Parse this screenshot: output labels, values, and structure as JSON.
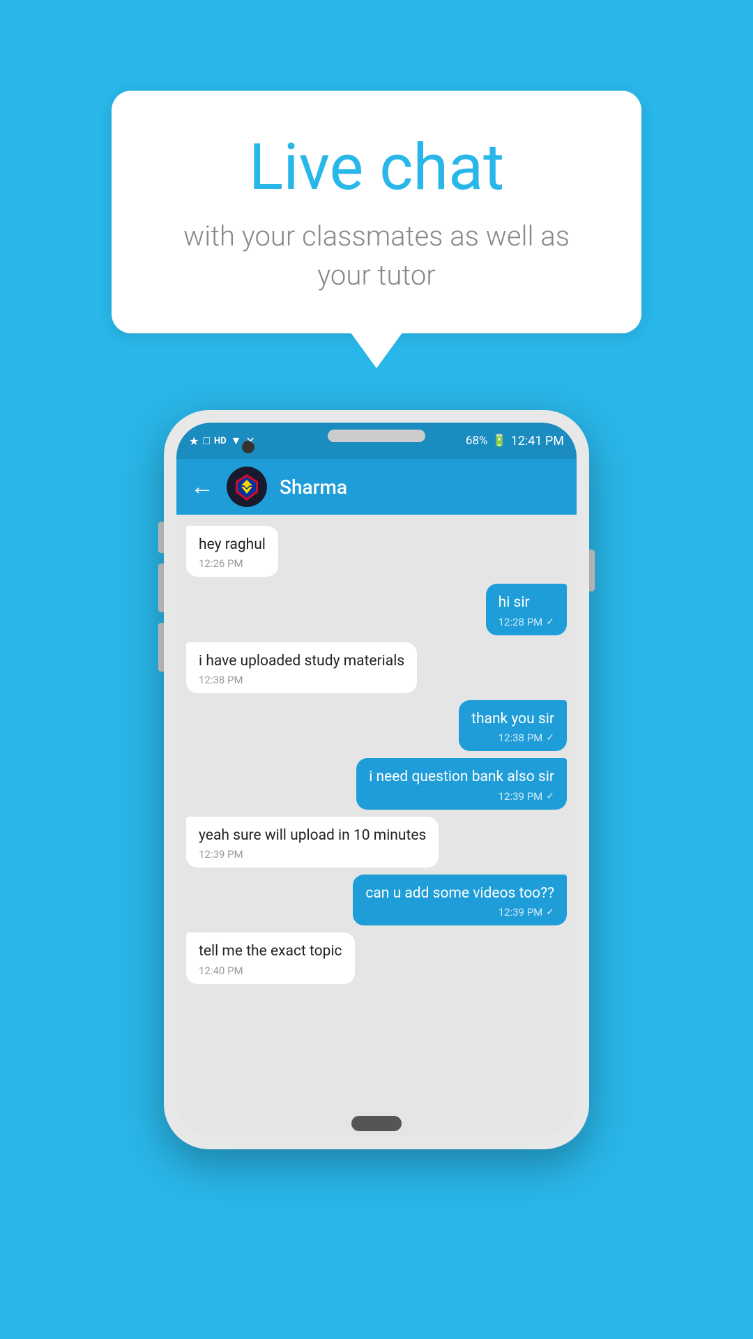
{
  "header": {
    "title": "Live chat",
    "subtitle": "with your classmates as well as your tutor"
  },
  "status_bar": {
    "time": "12:41 PM",
    "battery": "68%"
  },
  "app_header": {
    "contact_name": "Sharma"
  },
  "messages": [
    {
      "id": 1,
      "type": "received",
      "text": "hey raghul",
      "time": "12:26 PM",
      "read": false
    },
    {
      "id": 2,
      "type": "sent",
      "text": "hi sir",
      "time": "12:28 PM",
      "read": true
    },
    {
      "id": 3,
      "type": "received",
      "text": "i have uploaded study materials",
      "time": "12:38 PM",
      "read": false
    },
    {
      "id": 4,
      "type": "sent",
      "text": "thank you sir",
      "time": "12:38 PM",
      "read": true
    },
    {
      "id": 5,
      "type": "sent",
      "text": "i need question bank also sir",
      "time": "12:39 PM",
      "read": true
    },
    {
      "id": 6,
      "type": "received",
      "text": "yeah sure will upload in 10 minutes",
      "time": "12:39 PM",
      "read": false
    },
    {
      "id": 7,
      "type": "sent",
      "text": "can u add some videos too??",
      "time": "12:39 PM",
      "read": true
    },
    {
      "id": 8,
      "type": "received",
      "text": "tell me the exact topic",
      "time": "12:40 PM",
      "read": false
    }
  ]
}
